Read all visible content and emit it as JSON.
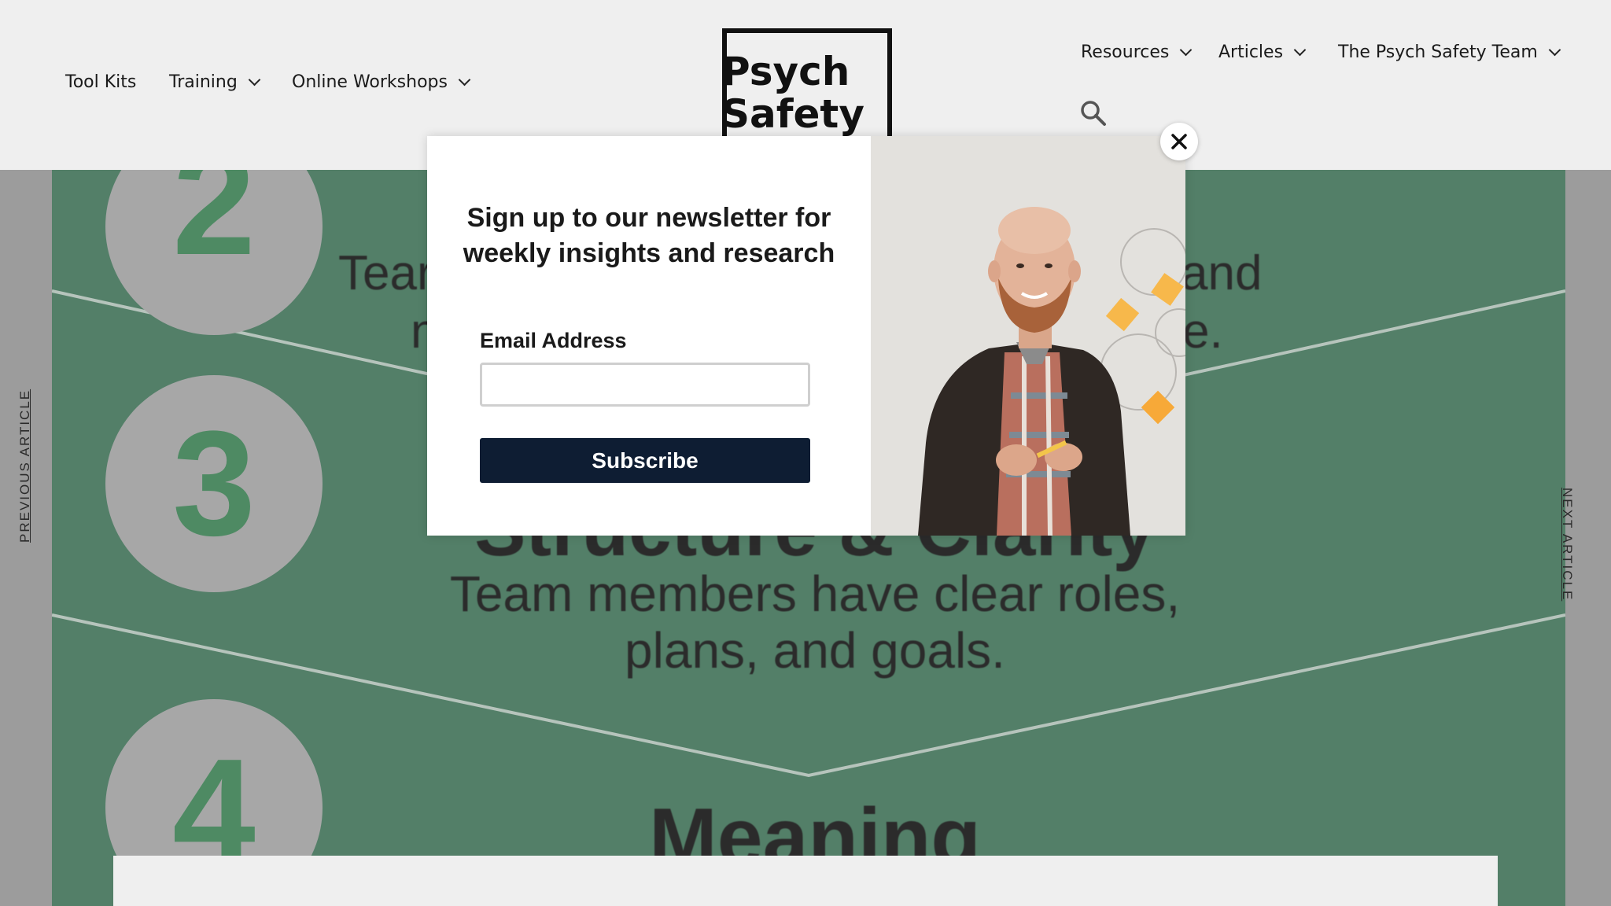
{
  "header": {
    "nav_left": [
      {
        "label": "Tool Kits"
      },
      {
        "label": "Training"
      },
      {
        "label": "Online Workshops"
      }
    ],
    "logo": {
      "line1": "Psych",
      "line2": "Safety"
    },
    "nav_right": [
      {
        "label": "Resources"
      },
      {
        "label": "Articles"
      },
      {
        "label": "The Psych Safety Team"
      }
    ]
  },
  "article": {
    "numbers": [
      "2",
      "3",
      "4"
    ],
    "row2_text_left_1": "Tear",
    "row2_text_right_1": "and",
    "row2_text_left_2": "n",
    "row2_text_right_2": "e.",
    "row3_heading_partial": "Structure & Clarity",
    "row3_desc_line1": "Team members have clear roles,",
    "row3_desc_line2": "plans, and goals.",
    "row4_heading": "Meaning",
    "prev_label": "PREVIOUS ARTICLE",
    "next_label": "NEXT ARTICLE"
  },
  "modal": {
    "title": "Sign up to our newsletter for weekly insights and research",
    "email_label": "Email Address",
    "email_value": "",
    "subscribe_label": "Subscribe",
    "close_icon": "close-icon",
    "photo_icon": "person-photo"
  },
  "colors": {
    "header_bg": "#efefef",
    "article_green": "#537f68",
    "button_navy": "#0e1d33"
  }
}
